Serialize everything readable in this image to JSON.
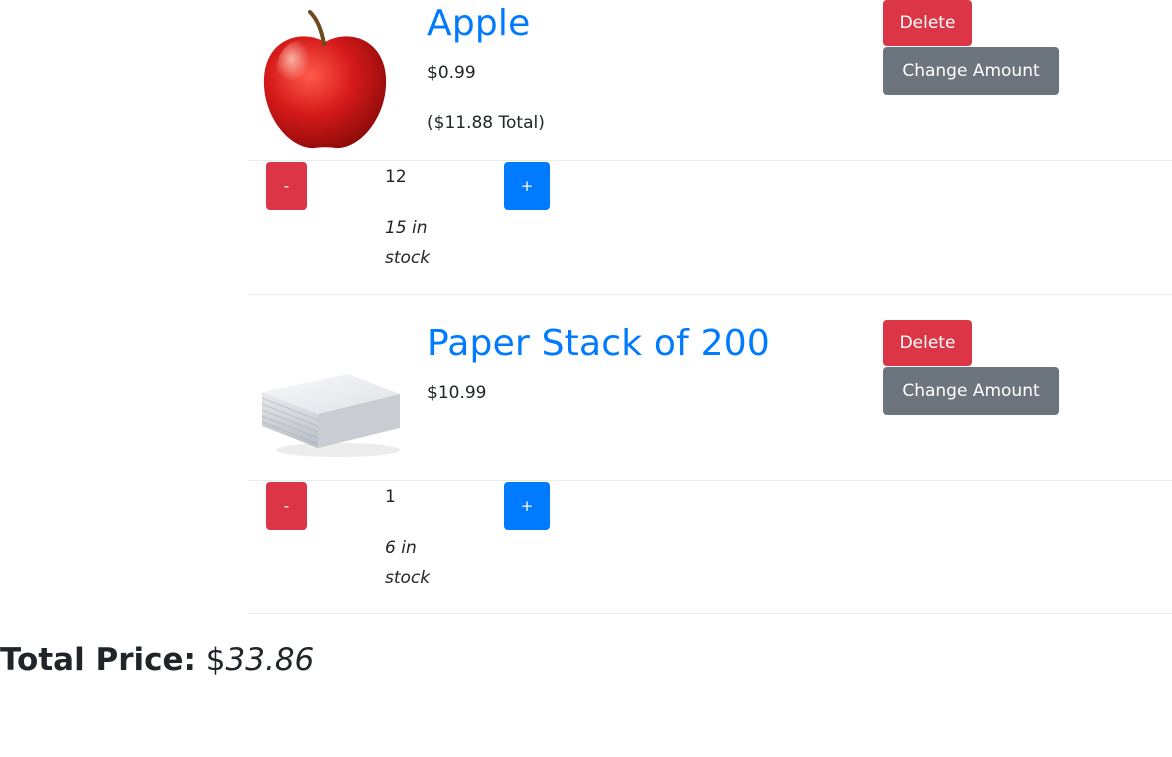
{
  "items": [
    {
      "name": "Apple",
      "price": "$0.99",
      "total": "($11.88 Total)",
      "quantity": "12",
      "stock": "15 in stock",
      "image_icon": "apple-image",
      "delete_label": "Delete",
      "change_label": "Change Amount",
      "minus_label": "-",
      "plus_label": "+"
    },
    {
      "name": "Paper Stack of 200",
      "price": "$10.99",
      "quantity": "1",
      "stock": "6 in stock",
      "image_icon": "paper-stack-image",
      "delete_label": "Delete",
      "change_label": "Change Amount",
      "minus_label": "-",
      "plus_label": "+"
    }
  ],
  "summary": {
    "label": "Total Price:",
    "currency": "$",
    "value": "33.86"
  },
  "colors": {
    "primary": "#007bff",
    "danger": "#dc3545",
    "secondary": "#6c757d",
    "divider": "#ececec"
  }
}
